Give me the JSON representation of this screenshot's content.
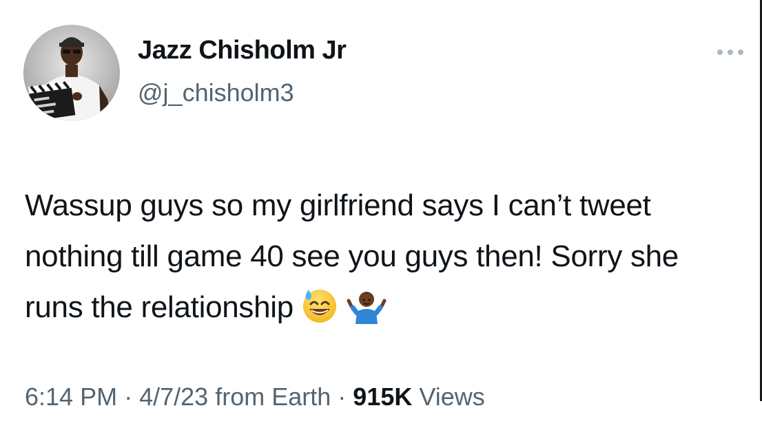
{
  "author": {
    "display_name": "Jazz Chisholm Jr",
    "handle": "@j_chisholm3"
  },
  "tweet": {
    "text": "Wassup guys so my girlfriend says I can’t tweet nothing till game 40 see you guys then! Sorry she runs the relationship",
    "emojis": [
      "grinning-face-with-sweat-emoji",
      "person-shrugging-emoji"
    ]
  },
  "meta": {
    "time": "6:14 PM",
    "separator": "·",
    "date": "4/7/23",
    "source": "from Earth",
    "views_count": "915K",
    "views_label": "Views"
  },
  "icons": {
    "more": "more-options-icon"
  },
  "colors": {
    "text_primary": "#0f1419",
    "text_secondary": "#536471",
    "more_icon": "#aab8c2",
    "background": "#ffffff"
  }
}
